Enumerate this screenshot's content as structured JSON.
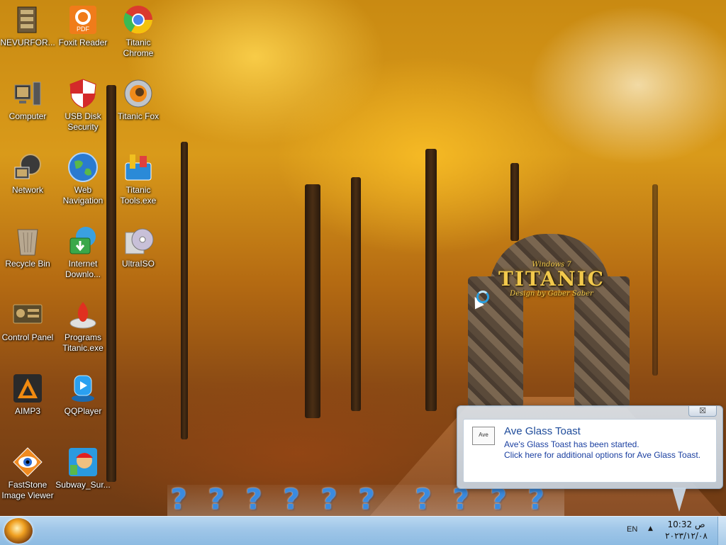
{
  "desktop": {
    "icons": [
      {
        "label": "NEVURFOR...",
        "icon": "archive-icon"
      },
      {
        "label": "Foxit Reader",
        "icon": "pdf-icon"
      },
      {
        "label": "Titanic Chrome",
        "icon": "chrome-icon"
      },
      {
        "label": "Computer",
        "icon": "computer-icon"
      },
      {
        "label": "USB Disk Security",
        "icon": "shield-icon"
      },
      {
        "label": "Titanic Fox",
        "icon": "firefox-icon"
      },
      {
        "label": "Network",
        "icon": "network-icon"
      },
      {
        "label": "Web Navigation",
        "icon": "globe-icon"
      },
      {
        "label": "Titanic Tools.exe",
        "icon": "tools-icon"
      },
      {
        "label": "Recycle Bin",
        "icon": "recycle-bin-icon"
      },
      {
        "label": "Internet Downlo...",
        "icon": "download-manager-icon"
      },
      {
        "label": "UltraISO",
        "icon": "disc-icon"
      },
      {
        "label": "Control Panel",
        "icon": "control-panel-icon"
      },
      {
        "label": "Programs Titanic.exe",
        "icon": "programs-icon"
      },
      {
        "label": "AIMP3",
        "icon": "aimp-icon"
      },
      {
        "label": "QQPlayer",
        "icon": "qqplayer-icon"
      },
      {
        "label": "FastStone Image Viewer",
        "icon": "eye-icon"
      },
      {
        "label": "Subway_Sur...",
        "icon": "subway-surfers-icon"
      }
    ],
    "wallpaper_sign": {
      "top": "Windows 7",
      "title": "TITANIC",
      "tagline": "Design by Gaber Saber"
    },
    "dock_icon": "question-mark-icon"
  },
  "toast": {
    "app_icon_label": "Ave",
    "title": "Ave Glass Toast",
    "line1": "Ave's Glass Toast has been started.",
    "line2": "Click here for additional options for Ave Glass Toast.",
    "close_symbol": "☒"
  },
  "taskbar": {
    "language": "EN",
    "time": "ص 10:32",
    "date": "٢٠٢٣/١٢/٠٨"
  },
  "colors": {
    "taskbar": "#9fc6e8",
    "toast_title": "#1e4b9a",
    "dock_question": "#3a8be0"
  }
}
